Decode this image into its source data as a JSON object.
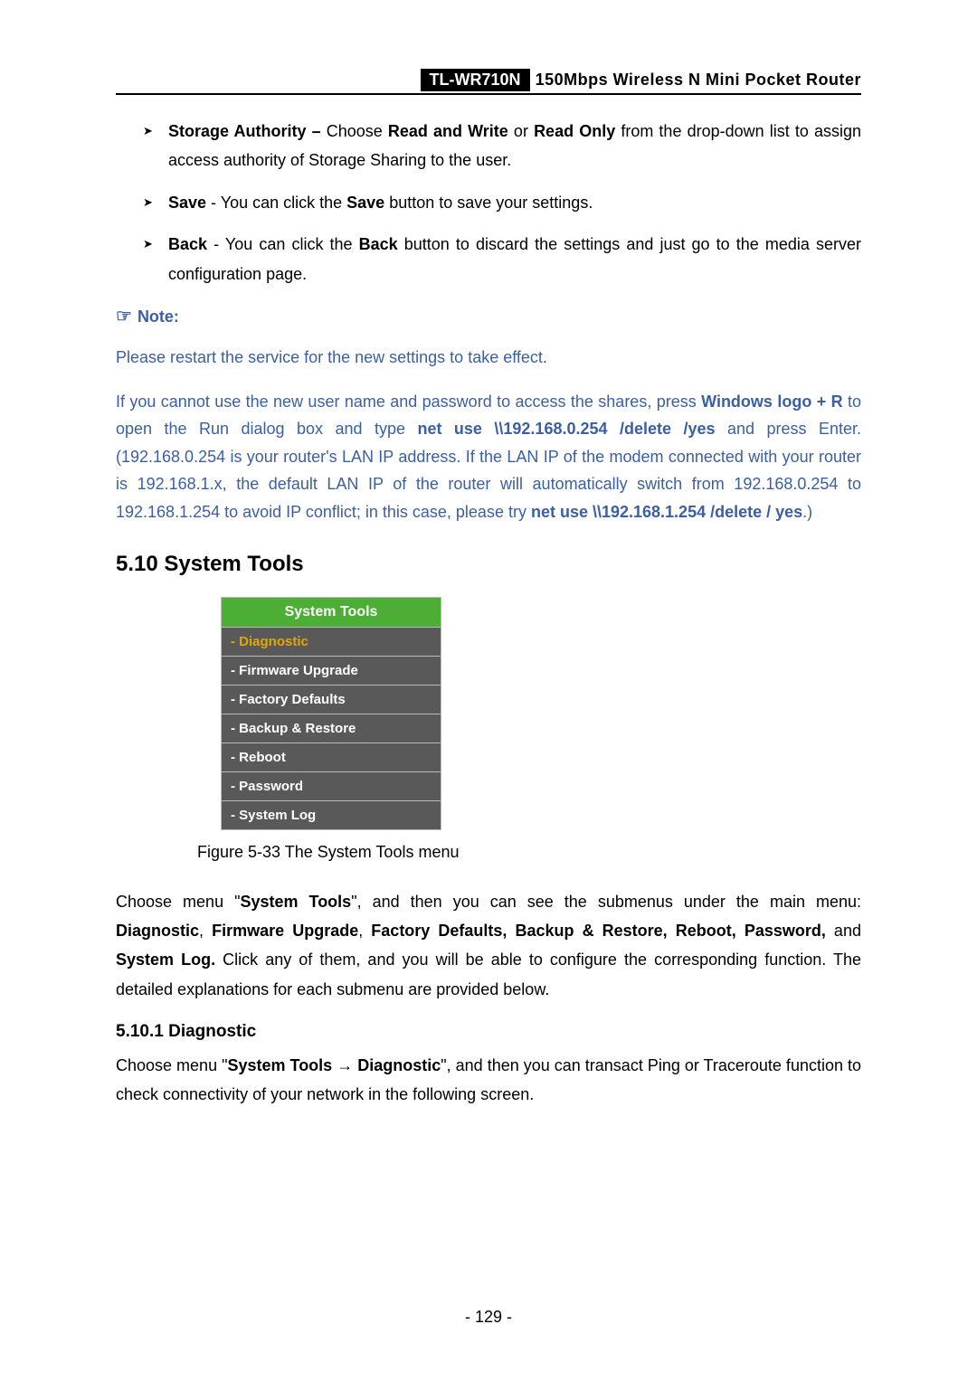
{
  "header": {
    "model": "TL-WR710N",
    "description": "150Mbps Wireless N Mini Pocket Router"
  },
  "bullets": {
    "storage_label": "Storage Authority –",
    "storage_mid": " Choose ",
    "storage_opt1": "Read and Write",
    "storage_or": " or ",
    "storage_opt2": "Read Only",
    "storage_tail": " from the drop-down list to assign access authority of Storage Sharing to the user.",
    "save_label": "Save",
    "save_mid": " - You can click the ",
    "save_btn": "Save",
    "save_tail": " button to save your settings.",
    "back_label": "Back",
    "back_mid": " - You can click the ",
    "back_btn": "Back",
    "back_tail": " button to discard the settings and just go to the media server configuration page."
  },
  "note": {
    "heading": "Note:",
    "hand": "☞",
    "p1": "Please restart the service for the new settings to take effect.",
    "p2a": "If you cannot use the new user name and password to access the shares, press ",
    "p2b": "Windows logo + R",
    "p2c": " to open the Run dialog box and type ",
    "p2d": "net use \\\\192.168.0.254 /delete /yes",
    "p2e": " and press Enter. (192.168.0.254 is your router's LAN IP address. If the LAN IP of the modem connected with your router is 192.168.1.x, the default LAN IP of the router will automatically switch from 192.168.0.254 to 192.168.1.254 to avoid IP conflict; in this case, please try ",
    "p2f": "net use \\\\192.168.1.254 /delete / yes",
    "p2g": ".)"
  },
  "section": {
    "number_title": "5.10  System Tools"
  },
  "menu": {
    "title": "System Tools",
    "items": [
      "- Diagnostic",
      "- Firmware Upgrade",
      "- Factory Defaults",
      "- Backup & Restore",
      "- Reboot",
      "- Password",
      "- System Log"
    ]
  },
  "figure_caption": "Figure 5-33 The System Tools menu",
  "para1": {
    "a": "Choose menu \"",
    "b": "System Tools",
    "c": "\", and then you can see the submenus under the main menu: ",
    "d": "Diagnostic",
    "e": ", ",
    "f": "Firmware Upgrade",
    "g": ", ",
    "h": "Factory Defaults, Backup & Restore, Reboot, Password,",
    "i": " and ",
    "j": "System Log.",
    "k": " Click any of them, and you will be able to configure the corresponding function. The detailed explanations for each submenu are provided below."
  },
  "subsection": "5.10.1 Diagnostic",
  "para2": {
    "a": "Choose menu \"",
    "b": "System Tools",
    "arrow": " → ",
    "c": "Diagnostic",
    "d": "\", and then you can transact Ping or Traceroute function to check connectivity of your network in the following screen."
  },
  "page_number": "- 129 -"
}
